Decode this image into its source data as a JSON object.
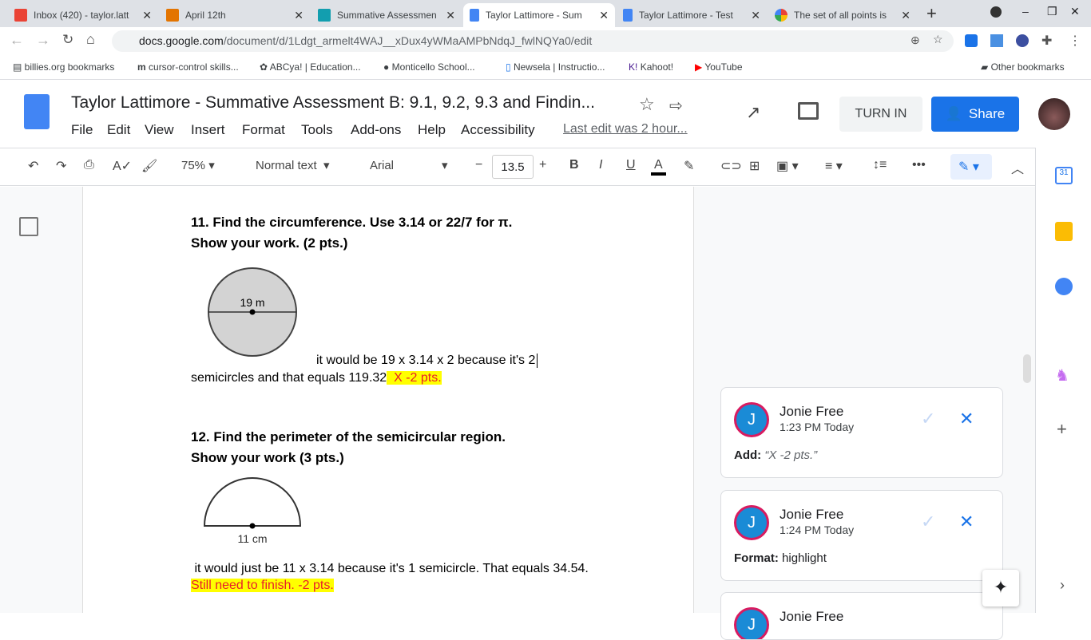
{
  "browser": {
    "tabs": [
      {
        "title": "Inbox (420) - taylor.latt",
        "color": "#ea4335"
      },
      {
        "title": "April 12th",
        "color": "#e37400"
      },
      {
        "title": "Summative Assessmen",
        "color": "#129eaf"
      },
      {
        "title": "Taylor Lattimore - Sum",
        "color": "#4285f4"
      },
      {
        "title": "Taylor Lattimore - Test",
        "color": "#4285f4"
      },
      {
        "title": "The set of all points is",
        "color": "#4285f4"
      }
    ],
    "url_host": "docs.google.com",
    "url_path": "/document/d/1Ldgt_armelt4WAJ__xDux4yWMaAMPbNdqJ_fwlNQYa0/edit",
    "bookmarks": [
      "billies.org bookmarks",
      "cursor-control skills...",
      "ABCya! | Education...",
      "Monticello School...",
      "Newsela | Instructio...",
      "Kahoot!",
      "YouTube"
    ],
    "other_bookmarks": "Other bookmarks"
  },
  "doc": {
    "title": "Taylor Lattimore - Summative Assessment B:  9.1, 9.2, 9.3 and Findin...",
    "menus": [
      "File",
      "Edit",
      "View",
      "Insert",
      "Format",
      "Tools",
      "Add-ons",
      "Help",
      "Accessibility"
    ],
    "last_edit": "Last edit was 2 hour...",
    "turn_in": "TURN IN",
    "share": "Share"
  },
  "toolbar": {
    "zoom": "75%",
    "style": "Normal text",
    "font": "Arial",
    "size": "13.5"
  },
  "content": {
    "q11_line1": "11.  Find the circumference.  Use 3.14 or 22/7 for π.",
    "q11_line2": "Show your work. (2 pts.)",
    "q11_fig_label": "19 m",
    "q11_ans1": "it would be 19 x 3.14 x 2 because it's 2",
    "q11_ans2": "semicircles and that equals 119.32",
    "q11_mark": "  X -2 pts.",
    "q12_line1": "12.  Find the perimeter of the semicircular region.",
    "q12_line2": "Show your work  (3 pts.)",
    "q12_fig_label": "11 cm",
    "q12_ans": " it would just be 11 x 3.14 because it's 1 semicircle. That equals 34.54.",
    "q12_mark": "Still need to finish.  -2 pts."
  },
  "comments": [
    {
      "initial": "J",
      "name": "Jonie Free",
      "time": "1:23 PM Today",
      "label": "Add:",
      "text": "“X -2 pts.”"
    },
    {
      "initial": "J",
      "name": "Jonie Free",
      "time": "1:24 PM Today",
      "label": "Format:",
      "text": "highlight"
    },
    {
      "initial": "J",
      "name": "Jonie Free"
    }
  ]
}
